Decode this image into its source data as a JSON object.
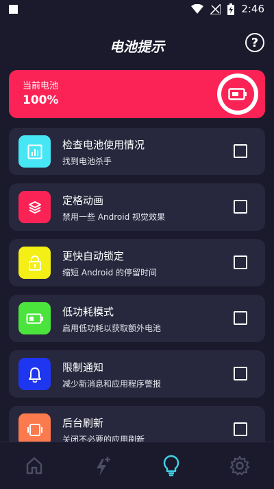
{
  "status": {
    "time": "2:46"
  },
  "header": {
    "title": "电池提示",
    "help_glyph": "?"
  },
  "battery": {
    "label": "当前电池",
    "value": "100%"
  },
  "items": [
    {
      "title": "检查电池使用情况",
      "subtitle": "找到电池杀手",
      "icon": "chart-icon",
      "color": "#46e6f5",
      "checked": false
    },
    {
      "title": "定格动画",
      "subtitle": "禁用一些 Android 视觉效果",
      "icon": "layers-icon",
      "color": "#fb2355",
      "checked": false
    },
    {
      "title": "更快自动锁定",
      "subtitle": "缩短 Android 的停留时间",
      "icon": "lock-icon",
      "color": "#f4ef14",
      "checked": false
    },
    {
      "title": "低功耗模式",
      "subtitle": "启用低功耗以获取额外电池",
      "icon": "battery-low-icon",
      "color": "#4be43c",
      "checked": false
    },
    {
      "title": "限制通知",
      "subtitle": "减少新消息和应用程序警报",
      "icon": "bell-icon",
      "color": "#1f36f0",
      "checked": false
    },
    {
      "title": "后台刷新",
      "subtitle": "关闭不必要的应用刷新",
      "icon": "refresh-icon",
      "color": "#fb7a4e",
      "checked": false
    }
  ],
  "nav": [
    {
      "icon": "home-icon",
      "active": false
    },
    {
      "icon": "charge-boost-icon",
      "active": false
    },
    {
      "icon": "lightbulb-icon",
      "active": true
    },
    {
      "icon": "gear-icon",
      "active": false
    }
  ],
  "colors": {
    "background": "#1a1a2c",
    "card": "#27273d",
    "accent": "#fb2355",
    "nav_active": "#3fd2e6",
    "nav_inactive": "#4d4d66"
  }
}
